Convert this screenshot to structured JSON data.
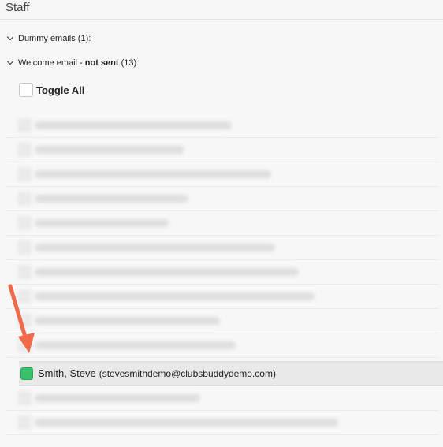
{
  "header": {
    "title": "Staff"
  },
  "sections": {
    "dummy": {
      "label": "Dummy emails (1):"
    },
    "welcome": {
      "label_prefix": "Welcome email - ",
      "label_bold": "not sent",
      "label_suffix": " (13):"
    }
  },
  "toggle_all": {
    "label": "Toggle All"
  },
  "selected_row": {
    "name": "Smith, Steve",
    "email": "(stevesmithdemo@clubsbuddydemo.com)"
  },
  "colors": {
    "checked": "#38c06a",
    "arrow": "#f06a4a"
  }
}
